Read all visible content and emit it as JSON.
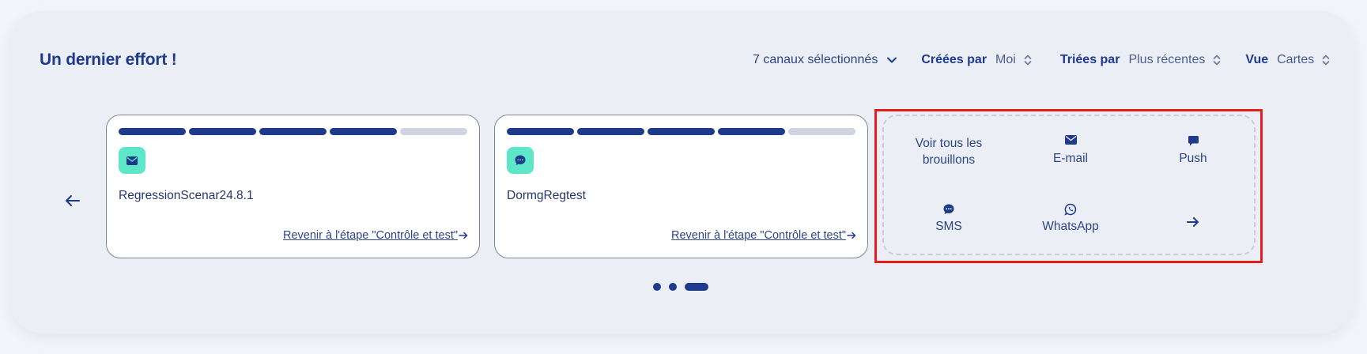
{
  "header": {
    "title": "Un dernier effort !",
    "channels_filter": "7 canaux sélectionnés",
    "created_by": {
      "label": "Créées par",
      "value": "Moi"
    },
    "sorted_by": {
      "label": "Triées par",
      "value": "Plus récentes"
    },
    "view": {
      "label": "Vue",
      "value": "Cartes"
    }
  },
  "cards": [
    {
      "name": "RegressionScenar24.8.1",
      "channel_icon": "email-icon",
      "link": "Revenir à l'étape \"Contrôle et test\"",
      "steps_done": 4,
      "steps_total": 5
    },
    {
      "name": "DormgRegtest",
      "channel_icon": "sms-icon",
      "link": "Revenir à l'étape \"Contrôle et test\"",
      "steps_done": 4,
      "steps_total": 5
    }
  ],
  "drafts": {
    "all_label_line1": "Voir tous les",
    "all_label_line2": "brouillons",
    "email": "E-mail",
    "push": "Push",
    "sms": "SMS",
    "whatsapp": "WhatsApp"
  },
  "pagination": {
    "pages": 3,
    "active": 3
  },
  "colors": {
    "primary": "#1e3a8a",
    "badge": "#5ee6c9",
    "panel": "#eceef5",
    "highlight": "#e41f1f"
  }
}
